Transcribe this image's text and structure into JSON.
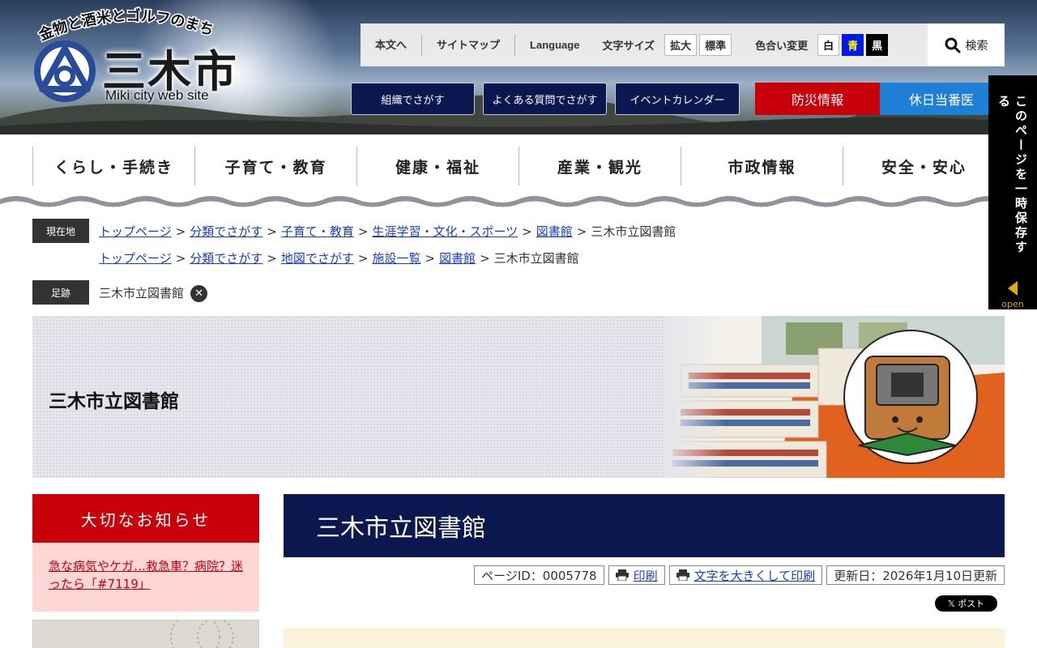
{
  "header": {
    "tagline": "金物と酒米とゴルフのまち",
    "city_name": "三木市",
    "site_sub": "Miki city web site",
    "util": {
      "honbun": "本文へ",
      "sitemap": "サイトマップ",
      "language": "Language",
      "font_size_label": "文字サイズ",
      "font_large": "拡大",
      "font_normal": "標準",
      "color_label": "色合い変更",
      "color_white": "白",
      "color_blue": "青",
      "color_black": "黒",
      "search": "検索"
    },
    "quick_links": [
      "組織でさがす",
      "よくある質問でさがす",
      "イベントカレンダー"
    ],
    "bousai": "防災情報",
    "kyujitsu": "休日当番医"
  },
  "side_tab": {
    "label": "このページを一時保存する",
    "open": "open"
  },
  "gnav": [
    "くらし・手続き",
    "子育て・教育",
    "健康・福祉",
    "産業・観光",
    "市政情報",
    "安全・安心"
  ],
  "breadcrumb": {
    "current_label": "現在地",
    "row1": [
      "トップページ",
      "分類でさがす",
      "子育て・教育",
      "生涯学習・文化・スポーツ",
      "図書館"
    ],
    "row1_last": "三木市立図書館",
    "row2": [
      "トップページ",
      "分類でさがす",
      "地図でさがす",
      "施設一覧",
      "図書館"
    ],
    "row2_last": "三木市立図書館",
    "sep": ">",
    "trail_label": "足跡",
    "trail_item": "三木市立図書館"
  },
  "banner": {
    "title": "三木市立図書館"
  },
  "notice": {
    "head": "大切なお知らせ",
    "link": "急な病気やケガ…救急車？病院？迷ったら「#7119」"
  },
  "main": {
    "title": "三木市立図書館",
    "page_id": "ページID：0005778",
    "print": "印刷",
    "print_large": "文字を大きくして印刷",
    "updated": "更新日：2026年1月10日更新",
    "x_post": "𝕏 ポスト"
  },
  "colors": {
    "navy": "#0b1850",
    "red": "#c8000a",
    "blue_alert": "#1e7fd6",
    "link": "#1a3fc2"
  }
}
